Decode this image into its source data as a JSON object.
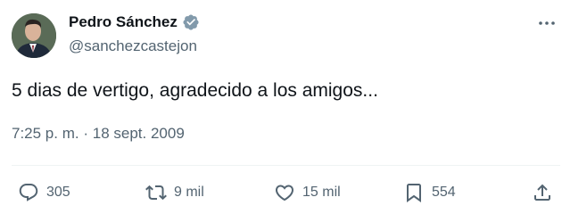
{
  "author": {
    "name": "Pedro Sánchez",
    "handle": "@sanchezcastejon",
    "verified": true
  },
  "tweet": {
    "text": "5 dias de vertigo, agradecido a los amigos...",
    "time": "7:25 p. m.",
    "separator": "·",
    "date": "18 sept. 2009"
  },
  "stats": {
    "replies": "305",
    "retweets": "9 mil",
    "likes": "15 mil",
    "bookmarks": "554"
  },
  "icons": {
    "avatar": "profile-photo",
    "verified": "verified-badge-icon",
    "more": "more-dots-icon",
    "reply": "reply-icon",
    "retweet": "retweet-icon",
    "like": "heart-icon",
    "bookmark": "bookmark-icon",
    "share": "share-icon"
  },
  "colors": {
    "text": "#0f1419",
    "secondary": "#536471",
    "verified_badge": "#829aab",
    "divider": "#eff3f4"
  }
}
